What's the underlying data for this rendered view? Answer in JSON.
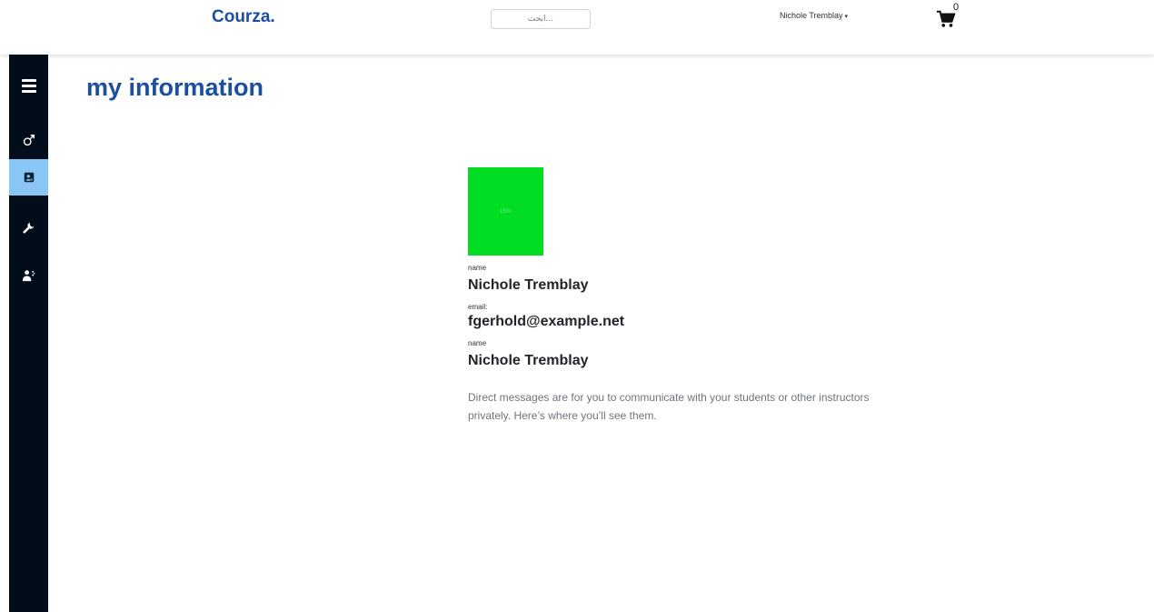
{
  "header": {
    "brand": "Courza.",
    "search_placeholder": "...ابحث",
    "user_name": "Nichole Tremblay",
    "cart_count": "0"
  },
  "sidebar": {
    "items": [
      {
        "icon": "menu-icon"
      },
      {
        "icon": "male-symbol-icon"
      },
      {
        "icon": "id-card-icon",
        "active": true
      },
      {
        "icon": "wrench-icon"
      },
      {
        "icon": "user-settings-icon"
      }
    ]
  },
  "main": {
    "title": "my information",
    "avatar_text": "150x",
    "name_label": "name",
    "name_value": "Nichole Tremblay",
    "email_label": "email:",
    "email_value": "fgerhold@example.net",
    "name2_label": "name",
    "name2_value": "Nichole Tremblay",
    "description": "Direct messages are for you to communicate with your students or other instructors privately. Here’s where you’ll see them."
  },
  "colors": {
    "brand": "#1c4fa0",
    "sidebar_bg": "#020d1b",
    "sidebar_active": "#8ac6f5",
    "avatar": "#00dd22"
  }
}
